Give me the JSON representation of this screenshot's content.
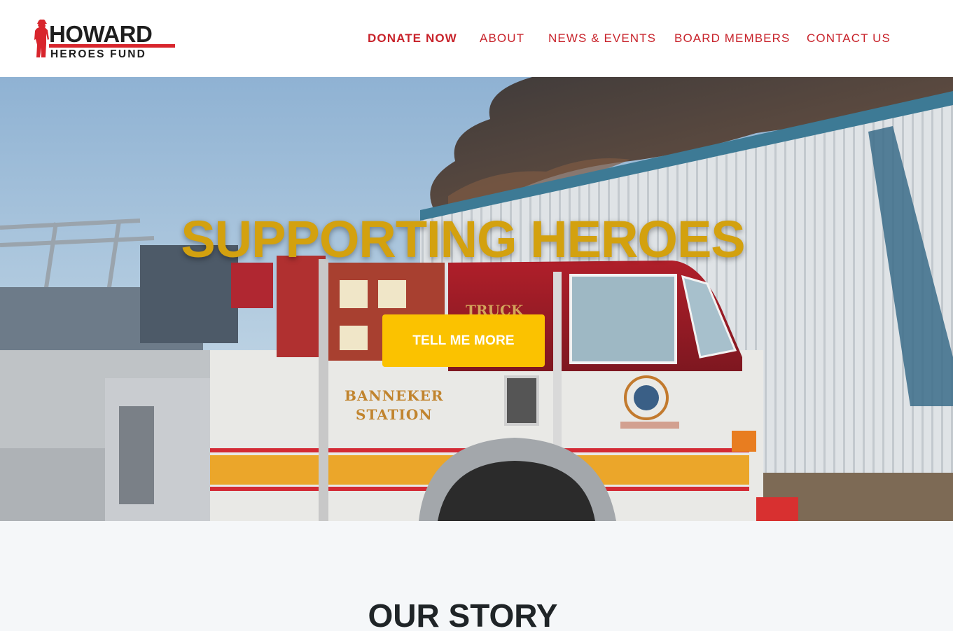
{
  "brand": {
    "logo_line1": "HOWARD",
    "logo_line2": "HEROES FUND",
    "red": "#c8232b",
    "gold": "#d3a10f",
    "yellow": "#fbc200"
  },
  "nav": {
    "items": [
      {
        "label": "DONATE NOW"
      },
      {
        "label": "ABOUT"
      },
      {
        "label": "NEWS & EVENTS"
      },
      {
        "label": "BOARD MEMBERS"
      },
      {
        "label": "CONTACT US"
      }
    ]
  },
  "hero": {
    "title": "SUPPORTING HEROES",
    "cta_label": "TELL ME MORE",
    "truck_text_line1": "BANNEKER",
    "truck_text_line2": "STATION",
    "truck_door_text": "TRUCK"
  },
  "story": {
    "title": "OUR STORY"
  }
}
